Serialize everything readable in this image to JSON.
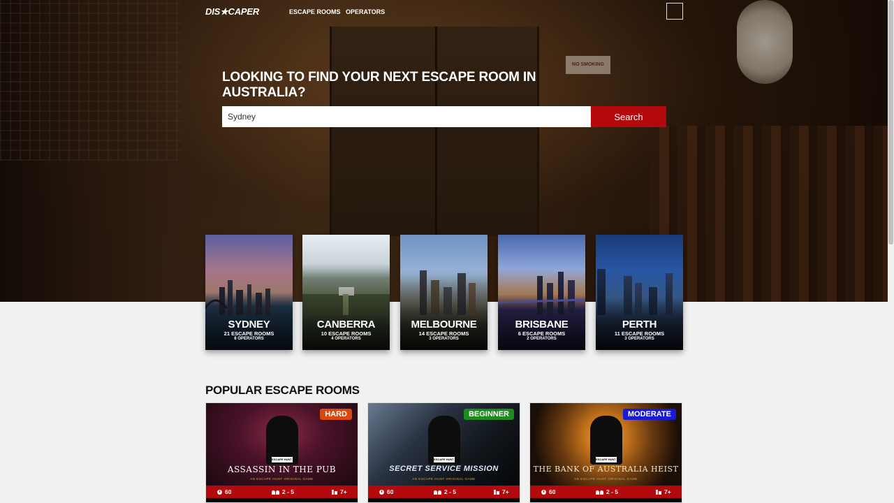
{
  "header": {
    "logo": "DIS★CAPER",
    "nav": [
      "ESCAPE ROOMS",
      "OPERATORS"
    ]
  },
  "hero": {
    "headline": "LOOKING TO FIND YOUR NEXT ESCAPE ROOM IN AUSTRALIA?",
    "search_value": "Sydney",
    "search_button": "Search",
    "sign_text": "NO SMOKING"
  },
  "cities": [
    {
      "name": "SYDNEY",
      "rooms": "21 ESCAPE ROOMS",
      "operators": "8 OPERATORS"
    },
    {
      "name": "CANBERRA",
      "rooms": "10 ESCAPE ROOMS",
      "operators": "4 OPERATORS"
    },
    {
      "name": "MELBOURNE",
      "rooms": "14 ESCAPE ROOMS",
      "operators": "3 OPERATORS"
    },
    {
      "name": "BRISBANE",
      "rooms": "6 ESCAPE ROOMS",
      "operators": "2 OPERATORS"
    },
    {
      "name": "PERTH",
      "rooms": "11 ESCAPE ROOMS",
      "operators": "3 OPERATORS"
    }
  ],
  "popular": {
    "title": "POPULAR ESCAPE ROOMS",
    "rooms": [
      {
        "title": "ASSASSIN IN THE PUB",
        "subtitle": "AN ESCAPE HUNT ORIGINAL GAME",
        "brand": "ESCAPE HUNT",
        "difficulty": "HARD",
        "difficulty_color": "#d9480f",
        "time": "60",
        "players": "2 - 5",
        "age": "7+"
      },
      {
        "title": "SECRET SERVICE MISSION",
        "subtitle": "AN ESCAPE HUNT ORIGINAL GAME",
        "brand": "ESCAPE HUNT",
        "difficulty": "BEGINNER",
        "difficulty_color": "#1c8a1c",
        "time": "60",
        "players": "2 - 5",
        "age": "7+"
      },
      {
        "title": "THE BANK OF AUSTRALIA HEIST",
        "subtitle": "AN ESCAPE HUNT ORIGINAL GAME",
        "brand": "ESCAPE HUNT",
        "difficulty": "MODERATE",
        "difficulty_color": "#1a1ad6",
        "time": "60",
        "players": "2 - 5",
        "age": "7+"
      }
    ]
  },
  "colors": {
    "accent": "#b3080c"
  }
}
